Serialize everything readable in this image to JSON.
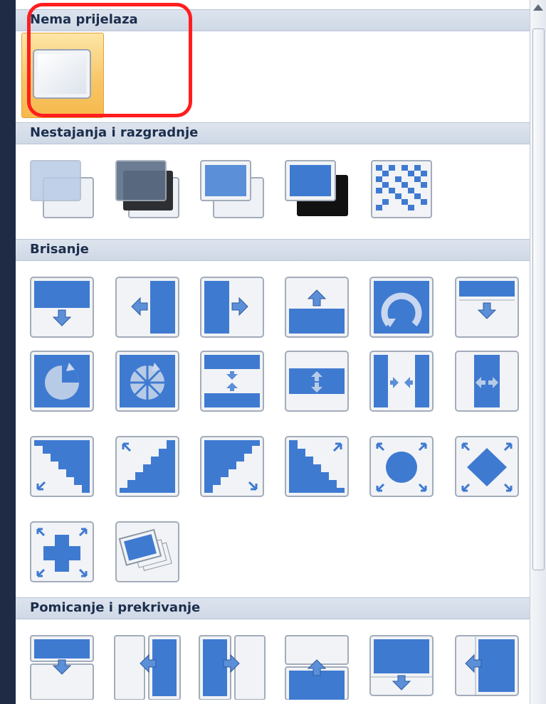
{
  "categories": [
    {
      "label": "Nema prijelaza"
    },
    {
      "label": "Nestajanja i razgradnje"
    },
    {
      "label": "Brisanje"
    },
    {
      "label": "Pomicanje i prekrivanje"
    }
  ],
  "colors": {
    "selection": "#f7c464",
    "highlight": "#ff1d1d",
    "category_header": "#d6dde9",
    "icon_blue": "#3f7ad1"
  }
}
